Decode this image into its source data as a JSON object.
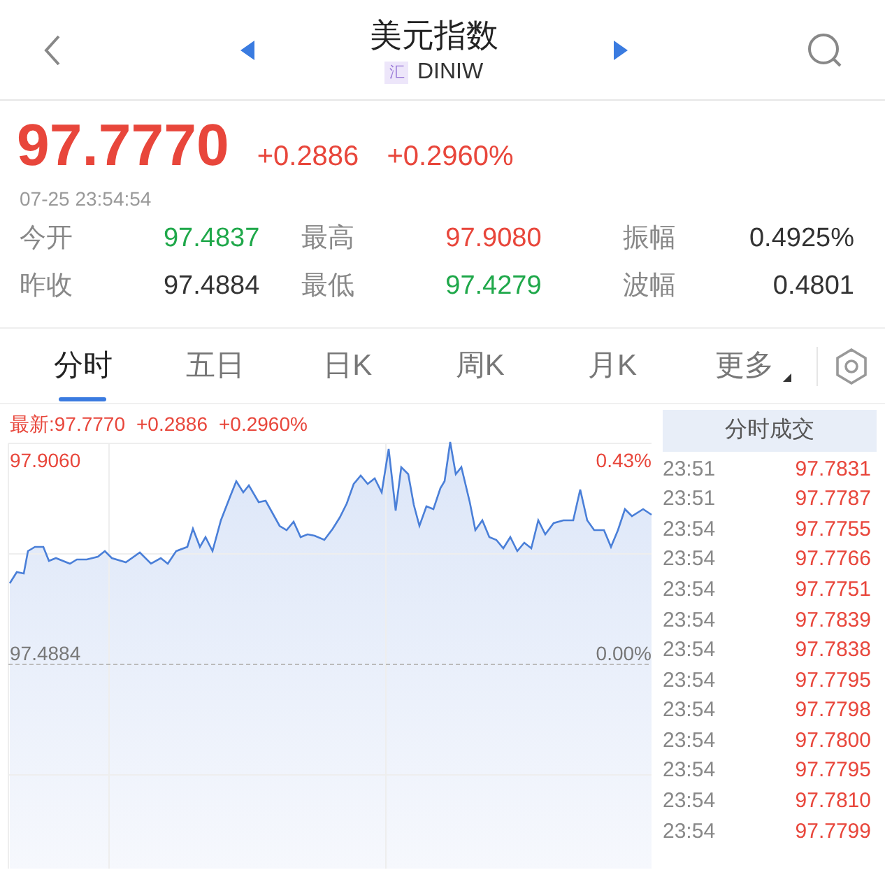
{
  "header": {
    "title": "美元指数",
    "badge": "汇",
    "code": "DINIW"
  },
  "quote": {
    "price": "97.7770",
    "change": "+0.2886",
    "change_pct": "+0.2960%",
    "time": "07-25 23:54:54"
  },
  "stats": [
    {
      "label": "今开",
      "value": "97.4837",
      "color": "#1fa84a"
    },
    {
      "label": "最高",
      "value": "97.9080",
      "color": "#e8463b"
    },
    {
      "label": "振幅",
      "value": "0.4925%",
      "color": "#333333"
    },
    {
      "label": "昨收",
      "value": "97.4884",
      "color": "#333333"
    },
    {
      "label": "最低",
      "value": "97.4279",
      "color": "#1fa84a"
    },
    {
      "label": "波幅",
      "value": "0.4801",
      "color": "#333333"
    }
  ],
  "tabs": [
    {
      "label": "分时",
      "selected": true,
      "dropdown": false
    },
    {
      "label": "五日",
      "selected": false,
      "dropdown": false
    },
    {
      "label": "日K",
      "selected": false,
      "dropdown": false
    },
    {
      "label": "周K",
      "selected": false,
      "dropdown": false
    },
    {
      "label": "月K",
      "selected": false,
      "dropdown": false
    },
    {
      "label": "更多",
      "selected": false,
      "dropdown": true
    }
  ],
  "chart": {
    "latest": "最新:97.7770",
    "change": "+0.2886",
    "change_pct": "+0.2960%",
    "top_price": "97.9060",
    "top_pct": "0.43%",
    "mid_price": "97.4884",
    "mid_pct": "0.00%"
  },
  "trades": {
    "title": "分时成交",
    "rows": [
      {
        "time": "23:51",
        "price": "97.7831"
      },
      {
        "time": "23:51",
        "price": "97.7787"
      },
      {
        "time": "23:54",
        "price": "97.7755"
      },
      {
        "time": "23:54",
        "price": "97.7766"
      },
      {
        "time": "23:54",
        "price": "97.7751"
      },
      {
        "time": "23:54",
        "price": "97.7839"
      },
      {
        "time": "23:54",
        "price": "97.7838"
      },
      {
        "time": "23:54",
        "price": "97.7795"
      },
      {
        "time": "23:54",
        "price": "97.7798"
      },
      {
        "time": "23:54",
        "price": "97.7800"
      },
      {
        "time": "23:54",
        "price": "97.7795"
      },
      {
        "time": "23:54",
        "price": "97.7810"
      },
      {
        "time": "23:54",
        "price": "97.7799"
      }
    ]
  }
}
